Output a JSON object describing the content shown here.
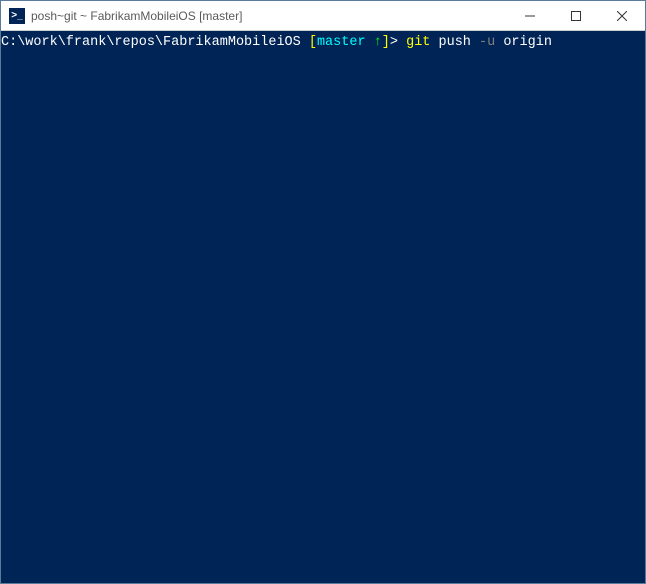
{
  "window": {
    "title": "posh~git ~ FabrikamMobileiOS [master]",
    "icon_text": ">_"
  },
  "terminal": {
    "path": "C:\\work\\frank\\repos\\FabrikamMobileiOS",
    "branch_open": " [",
    "branch_name": "master ",
    "branch_arrow": "↑",
    "branch_close": "]",
    "prompt_symbol": "> ",
    "cmd_git": "git",
    "cmd_push": " push ",
    "cmd_flag": "-u",
    "cmd_origin": " origin"
  }
}
